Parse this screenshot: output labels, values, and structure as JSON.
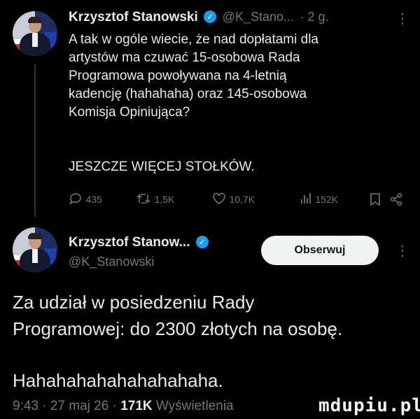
{
  "tweet1": {
    "author_name": "Krzysztof Stanowski",
    "handle": "@K_Stano...",
    "time": "· 2 g.",
    "more_icon": "⋮",
    "text_lines": [
      "A tak w ogóle wiecie, że nad dopłatami dla",
      "artystów ma czuwać 15-osobowa Rada",
      "Programowa powoływana na 4-letnią",
      "kadencję (hahahaha) oraz 145-osobowa",
      "Komisja Opiniująca?"
    ],
    "text_caps": "JESZCZE WIĘCEJ STOŁKÓW.",
    "actions": {
      "replies": "435",
      "retweets": "1,5K",
      "likes": "10,7K",
      "views": "152K"
    }
  },
  "tweet2": {
    "author_name": "Krzysztof Stanow...",
    "handle": "@K_Stanowski",
    "follow_label": "Obserwuj",
    "more_icon": "⋮",
    "text_lines": [
      "Za udział w posiedzeniu Rady",
      "Programowej: do 2300 złotych na osobę."
    ],
    "text_laugh": "Hahahahahahahahahaha.",
    "meta_time": "9:43 · 27 maj 26 · ",
    "meta_views_count": "171K",
    "meta_views_label": " Wyświetlenia"
  },
  "watermark": "mdupiu.pl",
  "colors": {
    "accent": "#1d9bf0",
    "muted": "#71767b",
    "text": "#e7e9ea"
  }
}
